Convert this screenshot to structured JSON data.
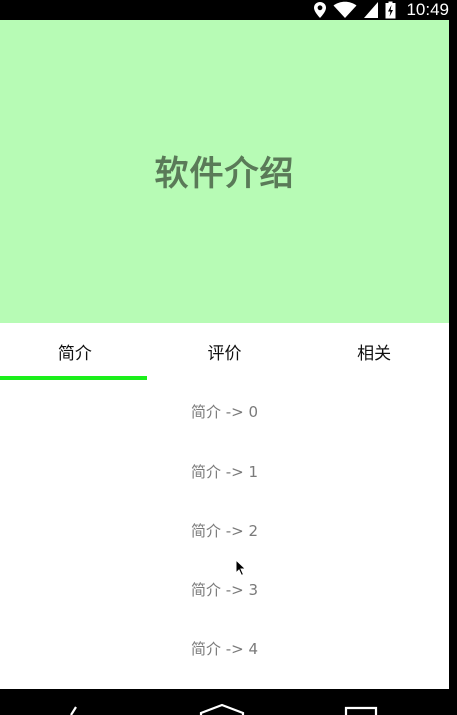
{
  "status_bar": {
    "time": "10:49",
    "icons": [
      "location-icon",
      "wifi-icon",
      "signal-icon",
      "battery-icon"
    ]
  },
  "header": {
    "title": "软件介绍",
    "background": "#b7fbb5"
  },
  "tabs": [
    {
      "label": "简介",
      "selected": true
    },
    {
      "label": "评价",
      "selected": false
    },
    {
      "label": "相关",
      "selected": false
    }
  ],
  "accent_color": "#1bef1b",
  "list": {
    "items": [
      "简介 -> 0",
      "简介 -> 1",
      "简介 -> 2",
      "简介 -> 3",
      "简介 -> 4"
    ]
  },
  "nav_bar": {
    "icons": [
      "back-icon",
      "home-icon",
      "recents-icon"
    ]
  }
}
